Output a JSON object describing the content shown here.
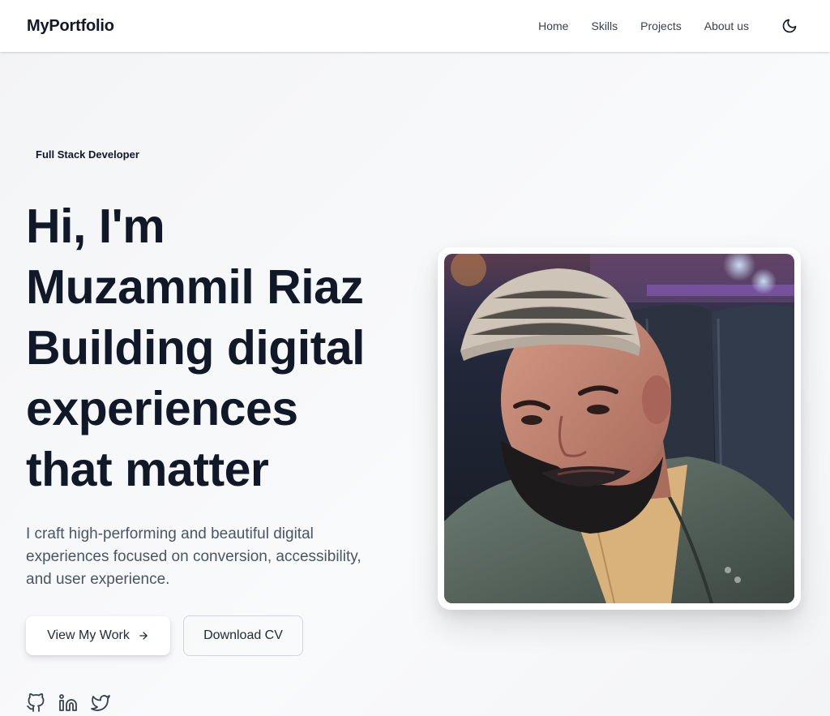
{
  "nav": {
    "brand": "MyPortfolio",
    "links": [
      "Home",
      "Skills",
      "Projects",
      "About us"
    ],
    "theme_icon": "moon-icon"
  },
  "hero": {
    "badge": "Full Stack Developer",
    "title_lines": [
      "Hi, I'm",
      "Muzammil Riaz",
      "Building digital",
      "experiences",
      "that matter"
    ],
    "description": "I craft high-performing and beautiful digital experiences focused on conversion, accessibility, and user experience.",
    "primary_button": "View My Work",
    "secondary_button": "Download CV",
    "social_icons": [
      "github-icon",
      "linkedin-icon",
      "twitter-icon"
    ]
  },
  "colors": {
    "text_primary": "#111827",
    "text_muted": "#4b5563",
    "border": "#d1d5db"
  }
}
